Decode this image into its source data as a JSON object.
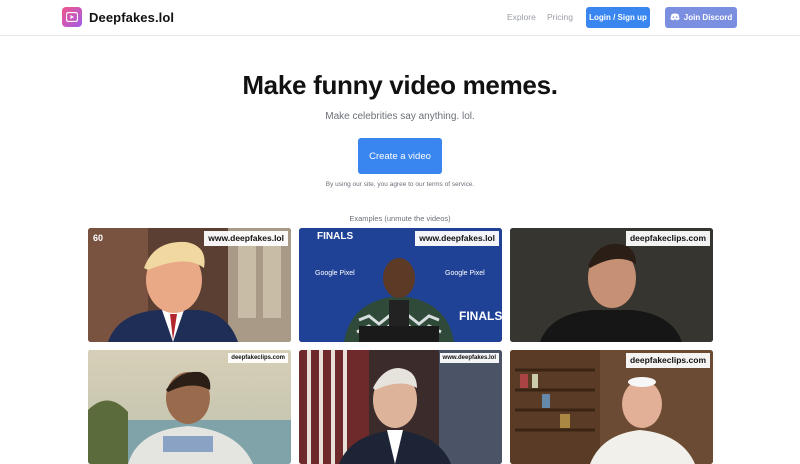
{
  "brand": {
    "name": "Deepfakes.lol",
    "accent": "#3a86f0"
  },
  "nav": {
    "links": [
      {
        "label": "Explore"
      },
      {
        "label": "Pricing"
      }
    ],
    "login_label": "Login / Sign up",
    "discord_label": "Join Discord"
  },
  "hero": {
    "title": "Make funny video memes.",
    "subtitle": "Make celebrities say anything. lol.",
    "cta_label": "Create a video",
    "terms": "By using our site, you agree to our terms of service."
  },
  "examples": {
    "label": "Examples (unmute the videos)",
    "tiles": [
      {
        "watermark": "www.deepfakes.lol",
        "badge": "60"
      },
      {
        "watermark": "www.deepfakes.lol",
        "overlay_top": "FINALS",
        "sponsor": "Google Pixel",
        "overlay_side": "FINALS"
      },
      {
        "watermark": "deepfakeclips.com"
      },
      {
        "watermark": "deepfakeclips.com"
      },
      {
        "watermark": "www.deepfakes.lol"
      },
      {
        "watermark": "deepfakeclips.com"
      }
    ]
  }
}
